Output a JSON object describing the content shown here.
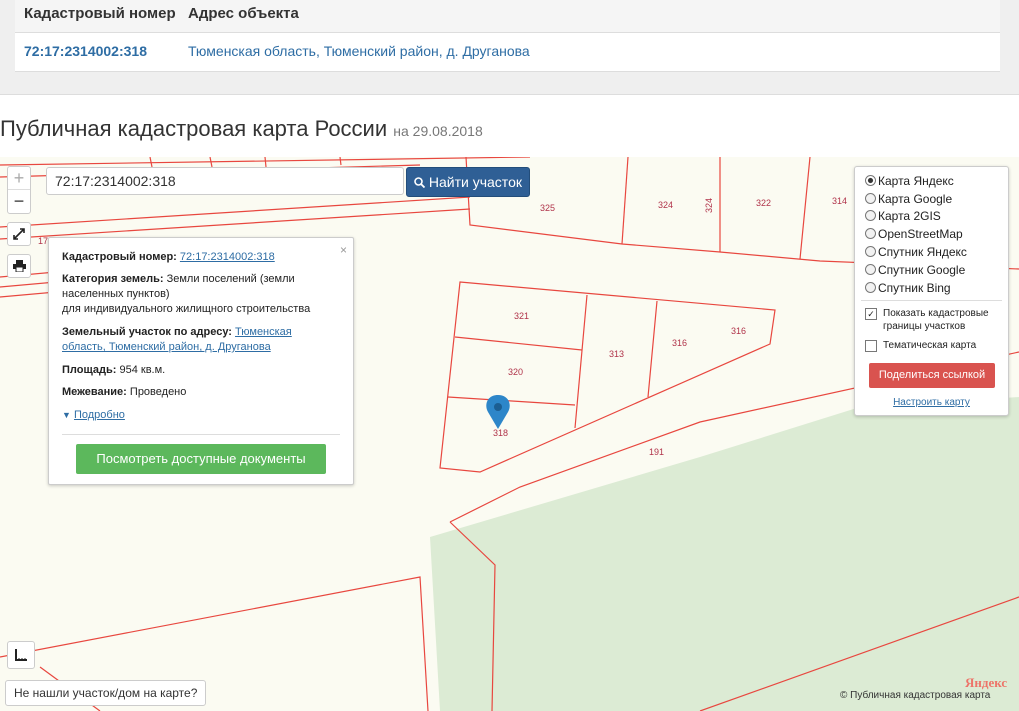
{
  "result_table": {
    "headers": [
      "Кадастровый номер",
      "Адрес объекта"
    ],
    "row": {
      "cadastral_number": "72:17:2314002:318",
      "address": "Тюменская область, Тюменский район, д. Друганова"
    }
  },
  "page": {
    "title": "Публичная кадастровая карта России",
    "date": "на 29.08.2018"
  },
  "map_controls": {
    "zoom_in": "+",
    "zoom_out": "−",
    "fullscreen_icon": "expand-icon",
    "print_icon": "printer-icon",
    "ruler_icon": "ruler-icon"
  },
  "search": {
    "value": "72:17:2314002:318",
    "button_label": "Найти участок"
  },
  "parcel_labels": [
    "325",
    "324",
    "324",
    "322",
    "314",
    "321",
    "320",
    "318",
    "313",
    "316",
    "316",
    "191",
    "17"
  ],
  "popup": {
    "close": "×",
    "cadastral_label": "Кадастровый номер:",
    "cadastral_value": "72:17:2314002:318",
    "category_label": "Категория земель:",
    "category_value_1": "Земли поселений (земли",
    "category_value_2": "населенных пунктов)",
    "category_value_3": "для индивидуального жилищного строительства",
    "address_label": "Земельный участок по адресу:",
    "address_value_1": "Тюменская",
    "address_value_2": "область, Тюменский район, д. Друганова",
    "area_label": "Площадь:",
    "area_value": "954 кв.м.",
    "survey_label": "Межевание:",
    "survey_value": "Проведено",
    "more": "Подробно",
    "docs_button": "Посмотреть доступные документы"
  },
  "layers": {
    "options": [
      "Карта Яндекс",
      "Карта Google",
      "Карта 2GIS",
      "OpenStreetMap",
      "Спутник Яндекс",
      "Спутник Google",
      "Спутник Bing"
    ],
    "selected": "Карта Яндекс",
    "show_borders": "Показать кадастровые границы участков",
    "show_borders_checked": true,
    "thematic": "Тематическая карта",
    "thematic_checked": false,
    "share_button": "Поделиться ссылкой",
    "setup_link": "Настроить карту"
  },
  "footer": {
    "not_found": "Не нашли участок/дом на карте?",
    "copyright": "© Публичная кадастровая карта",
    "yandex": "Яндекс"
  },
  "colors": {
    "parcel_border": "#e8473f",
    "parcel_label": "#b0334a",
    "forest": "#dcebd4",
    "link": "#2e6da4",
    "search_button": "#2f5f95",
    "docs_button": "#5cb85c",
    "share_button": "#d9534f",
    "marker": "#2d86c9"
  }
}
